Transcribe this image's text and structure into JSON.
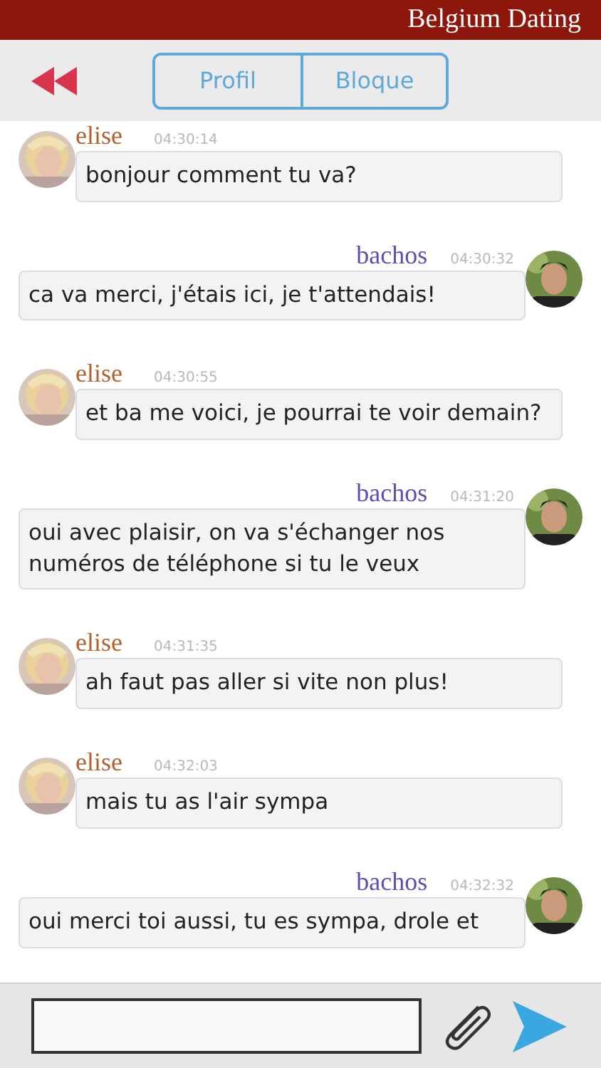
{
  "app_title": "Belgium Dating",
  "toolbar": {
    "segments": [
      {
        "label": "Profil"
      },
      {
        "label": "Bloque"
      }
    ]
  },
  "messages": [
    {
      "kind": "incoming",
      "sender": "elise",
      "time": "04:30:14",
      "text": "bonjour comment tu va?"
    },
    {
      "kind": "outgoing",
      "sender": "bachos",
      "time": "04:30:32",
      "text": "ca va merci, j'étais ici, je t'attendais!"
    },
    {
      "kind": "incoming",
      "sender": "elise",
      "time": "04:30:55",
      "text": "et ba me voici, je pourrai te voir demain?"
    },
    {
      "kind": "outgoing",
      "sender": "bachos",
      "time": "04:31:20",
      "text": "oui avec plaisir, on va s'échanger nos numéros de téléphone si tu le veux"
    },
    {
      "kind": "incoming",
      "sender": "elise",
      "time": "04:31:35",
      "text": "ah faut pas aller si vite non plus!"
    },
    {
      "kind": "incoming",
      "sender": "elise",
      "time": "04:32:03",
      "text": "mais tu as l'air sympa"
    },
    {
      "kind": "outgoing",
      "sender": "bachos",
      "time": "04:32:32",
      "text": "oui merci toi aussi, tu es sympa, drole et"
    }
  ]
}
